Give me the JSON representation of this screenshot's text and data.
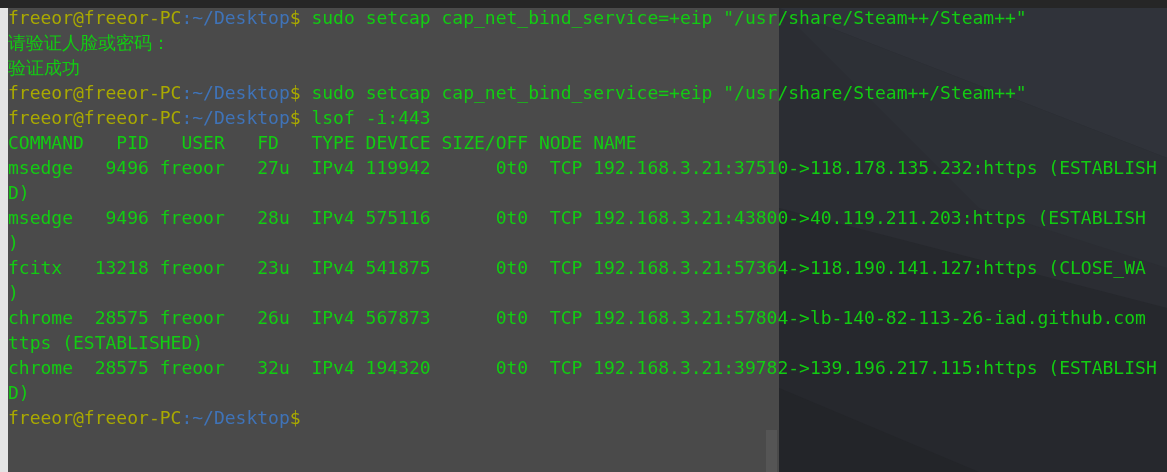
{
  "terminal": {
    "lines": [
      {
        "kind": "prompt",
        "user_host": "freeor@freeor-PC",
        "path": ":~/Desktop",
        "sign": "$",
        "command": " sudo setcap cap_net_bind_service=+eip \"/usr/share/Steam++/Steam++\""
      },
      {
        "kind": "output",
        "text": "请验证人脸或密码："
      },
      {
        "kind": "output",
        "text": "验证成功"
      },
      {
        "kind": "prompt",
        "user_host": "freeor@freeor-PC",
        "path": ":~/Desktop",
        "sign": "$",
        "command": " sudo setcap cap_net_bind_service=+eip \"/usr/share/Steam++/Steam++\""
      },
      {
        "kind": "prompt",
        "user_host": "freeor@freeor-PC",
        "path": ":~/Desktop",
        "sign": "$",
        "command": " lsof -i:443"
      },
      {
        "kind": "output",
        "text": "COMMAND   PID   USER   FD   TYPE DEVICE SIZE/OFF NODE NAME"
      },
      {
        "kind": "output",
        "text": "msedge   9496 freoor   27u  IPv4 119942      0t0  TCP 192.168.3.21:37510->118.178.135.232:https (ESTABLISH"
      },
      {
        "kind": "output",
        "text": "D)"
      },
      {
        "kind": "output",
        "text": "msedge   9496 freoor   28u  IPv4 575116      0t0  TCP 192.168.3.21:43800->40.119.211.203:https (ESTABLISH"
      },
      {
        "kind": "output",
        "text": ")"
      },
      {
        "kind": "output",
        "text": "fcitx   13218 freoor   23u  IPv4 541875      0t0  TCP 192.168.3.21:57364->118.190.141.127:https (CLOSE_WA"
      },
      {
        "kind": "output",
        "text": ")"
      },
      {
        "kind": "output",
        "text": "chrome  28575 freoor   26u  IPv4 567873      0t0  TCP 192.168.3.21:57804->lb-140-82-113-26-iad.github.com"
      },
      {
        "kind": "output",
        "text": "ttps (ESTABLISHED)"
      },
      {
        "kind": "output",
        "text": "chrome  28575 freoor   32u  IPv4 194320      0t0  TCP 192.168.3.21:39782->139.196.217.115:https (ESTABLISH"
      },
      {
        "kind": "output",
        "text": "D)"
      },
      {
        "kind": "prompt",
        "user_host": "freeor@freeor-PC",
        "path": ":~/Desktop",
        "sign": "$"
      }
    ]
  }
}
